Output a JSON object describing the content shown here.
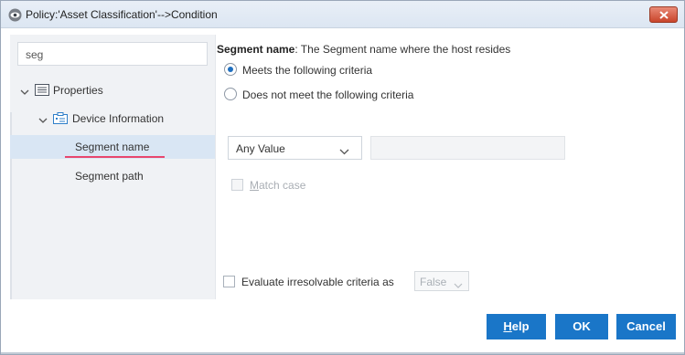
{
  "window": {
    "title": "Policy:'Asset Classification'-->Condition"
  },
  "sidebar": {
    "search_value": "seg",
    "tree": [
      {
        "label": "Properties",
        "icon": "list-icon",
        "expanded": true
      },
      {
        "label": "Device Information",
        "icon": "device-info-icon",
        "expanded": true
      },
      {
        "label": "Segment name",
        "selected": true
      },
      {
        "label": "Segment path",
        "selected": false
      }
    ]
  },
  "main": {
    "heading_bold": "Segment name",
    "heading_rest": ": The Segment name where the host resides",
    "radios": [
      {
        "label": "Meets the following criteria",
        "checked": true
      },
      {
        "label": "Does not meet the following criteria",
        "checked": false
      }
    ],
    "operator_select": {
      "value": "Any Value"
    },
    "value_input": {
      "value": ""
    },
    "match_case": {
      "label_underlined": "M",
      "label_rest": "atch case",
      "checked": false,
      "disabled": true
    },
    "evaluate": {
      "label": "Evaluate irresolvable criteria as",
      "checked": false,
      "value": "False"
    }
  },
  "footer": {
    "help_underlined": "H",
    "help_rest": "elp",
    "ok_label": "OK",
    "cancel_label": "Cancel"
  },
  "colors": {
    "accent": "#1a76c8",
    "selected_row": "#d9e6f4",
    "underline_mark": "#e8466e",
    "close_button": "#c9452b"
  }
}
